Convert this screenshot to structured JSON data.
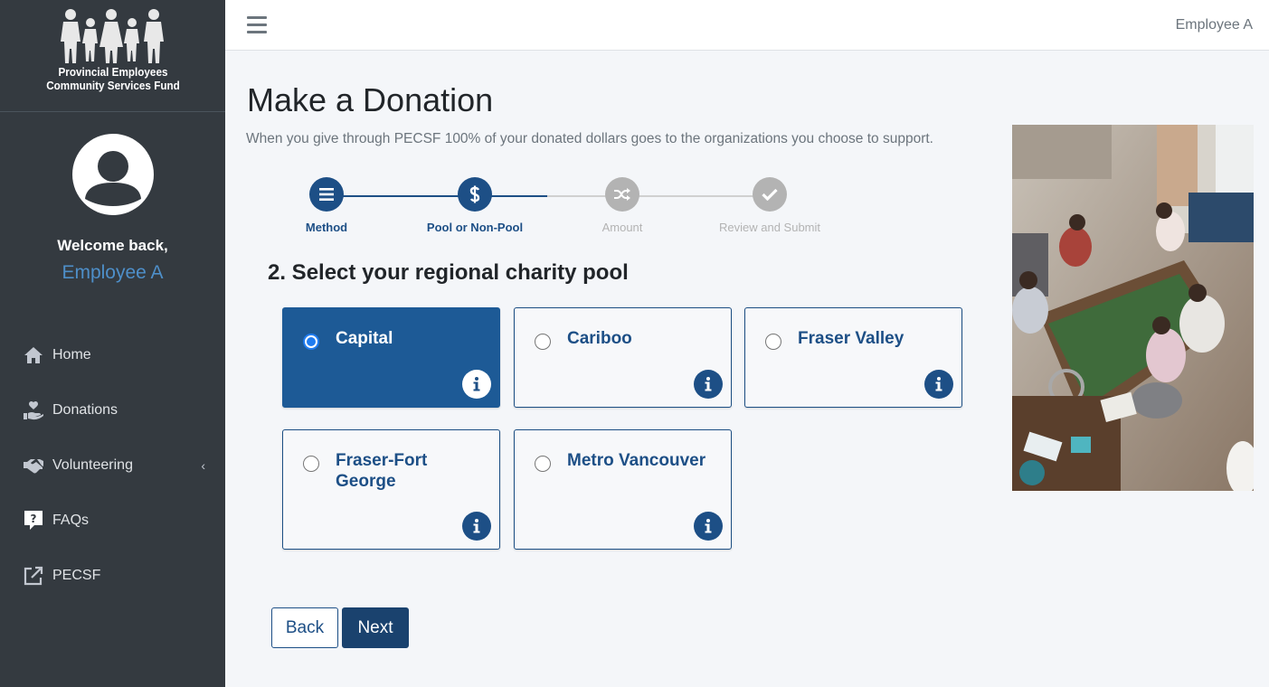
{
  "brand": {
    "line1": "Provincial Employees",
    "line2": "Community Services Fund"
  },
  "user_panel": {
    "welcome": "Welcome back,",
    "name": "Employee A"
  },
  "nav": {
    "items": [
      {
        "label": "Home",
        "icon": "home-icon"
      },
      {
        "label": "Donations",
        "icon": "hand-holding-heart-icon"
      },
      {
        "label": "Volunteering",
        "icon": "handshake-icon"
      },
      {
        "label": "FAQs",
        "icon": "question-comment-icon"
      },
      {
        "label": "PECSF",
        "icon": "external-link-icon"
      }
    ],
    "volunteering_chevron": "‹"
  },
  "topbar": {
    "user": "Employee A"
  },
  "page": {
    "title": "Make a Donation",
    "subtitle": "When you give through PECSF 100% of your donated dollars goes to the organizations you choose to support."
  },
  "stepper": {
    "steps": [
      {
        "label": "Method",
        "icon": "list-icon",
        "state": "complete"
      },
      {
        "label": "Pool or Non-Pool",
        "icon": "dollar-icon",
        "state": "current"
      },
      {
        "label": "Amount",
        "icon": "random-icon",
        "state": "upcoming"
      },
      {
        "label": "Review and Submit",
        "icon": "check-icon",
        "state": "upcoming"
      }
    ]
  },
  "section": {
    "title": "2. Select your regional charity pool"
  },
  "pools": [
    {
      "label": "Capital",
      "selected": true
    },
    {
      "label": "Cariboo",
      "selected": false
    },
    {
      "label": "Fraser Valley",
      "selected": false
    },
    {
      "label": "Fraser-Fort George",
      "selected": false
    },
    {
      "label": "Metro Vancouver",
      "selected": false
    }
  ],
  "buttons": {
    "back": "Back",
    "next": "Next"
  },
  "colors": {
    "sidebar": "#343a40",
    "primary": "#1d4f86",
    "selected_card": "#1d5a96",
    "next_button": "#1a426e",
    "inactive_step": "#b3b3b3",
    "username": "#4e8fc9"
  }
}
